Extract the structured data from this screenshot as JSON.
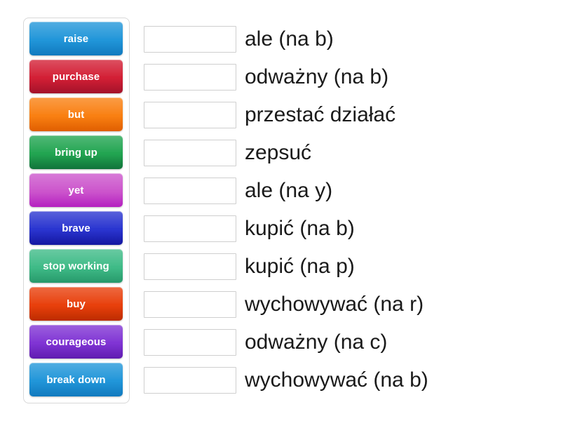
{
  "activity": {
    "type": "match-up-drag-and-drop",
    "tile_text_color": "#ffffff",
    "panel_border_color": "#d8d8d8",
    "slot_border_color": "#cfcfcf",
    "prompt_text_color": "#1a1a1a"
  },
  "tiles": [
    {
      "label": "raise",
      "color": "#2196d9",
      "color_dark": "#1179be"
    },
    {
      "label": "purchase",
      "color": "#d31f35",
      "color_dark": "#a3122a"
    },
    {
      "label": "but",
      "color": "#f98012",
      "color_dark": "#e05e00"
    },
    {
      "label": "bring up",
      "color": "#22a551",
      "color_dark": "#11733a"
    },
    {
      "label": "yet",
      "color": "#d martial",
      "color_dark": "#b41fc0"
    },
    {
      "label": "brave",
      "color": "#2a35d0",
      "color_dark": "#1417a0"
    },
    {
      "label": "stop working",
      "color": "#3fbb87",
      "color_dark": "#27996b"
    },
    {
      "label": "buy",
      "color": "#e8400c",
      "color_dark": "#bc2c00"
    },
    {
      "label": "courageous",
      "color": "#8034d4",
      "color_dark": "#5f1cb0"
    },
    {
      "label": "break down",
      "color": "#2196d9",
      "color_dark": "#1179be"
    }
  ],
  "rows": [
    {
      "slot_value": "",
      "prompt": "ale (na b)"
    },
    {
      "slot_value": "",
      "prompt": "odważny (na b)"
    },
    {
      "slot_value": "",
      "prompt": "przestać działać"
    },
    {
      "slot_value": "",
      "prompt": "zepsuć"
    },
    {
      "slot_value": "",
      "prompt": "ale (na y)"
    },
    {
      "slot_value": "",
      "prompt": "kupić (na b)"
    },
    {
      "slot_value": "",
      "prompt": "kupić (na p)"
    },
    {
      "slot_value": "",
      "prompt": "wychowywać (na r)"
    },
    {
      "slot_value": "",
      "prompt": "odważny (na c)"
    },
    {
      "slot_value": "",
      "prompt": "wychowywać (na b)"
    }
  ]
}
